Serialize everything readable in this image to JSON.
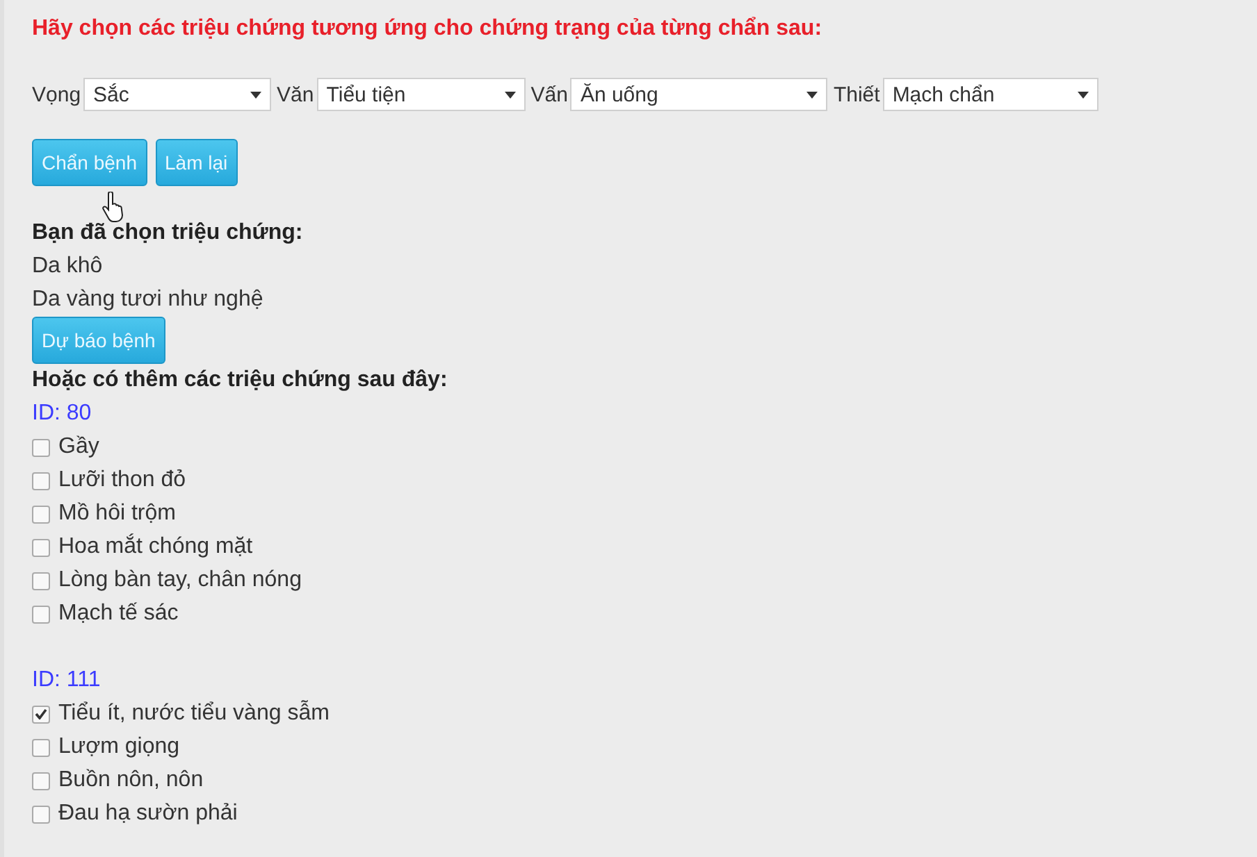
{
  "heading": "Hãy chọn các triệu chứng tương ứng cho chứng trạng của từng chẩn sau:",
  "filters": [
    {
      "label": "Vọng",
      "value": "Sắc"
    },
    {
      "label": "Văn",
      "value": "Tiểu tiện"
    },
    {
      "label": "Vấn",
      "value": "Ăn uống"
    },
    {
      "label": "Thiết",
      "value": "Mạch chẩn"
    }
  ],
  "actions": [
    "Chẩn bệnh",
    "Làm lại"
  ],
  "chosen": {
    "title": "Bạn đã chọn triệu chứng:",
    "items": [
      "Da khô",
      "Da vàng tươi như nghệ"
    ]
  },
  "predict_button": "Dự báo bệnh",
  "more": {
    "title": "Hoặc có thêm các triệu chứng sau đây:",
    "groups": [
      {
        "id": "ID: 80",
        "items": [
          {
            "label": "Gầy",
            "checked": false
          },
          {
            "label": "Lưỡi thon đỏ",
            "checked": false
          },
          {
            "label": "Mồ hôi trộm",
            "checked": false
          },
          {
            "label": "Hoa mắt chóng mặt",
            "checked": false
          },
          {
            "label": "Lòng bàn tay, chân nóng",
            "checked": false
          },
          {
            "label": "Mạch tế sác",
            "checked": false
          }
        ]
      },
      {
        "id": "ID: 111",
        "items": [
          {
            "label": "Tiểu ít, nước tiểu vàng sẫm",
            "checked": true
          },
          {
            "label": "Lượm giọng",
            "checked": false
          },
          {
            "label": "Buồn nôn, nôn",
            "checked": false
          },
          {
            "label": "Đau hạ sườn phải",
            "checked": false
          }
        ]
      }
    ]
  }
}
